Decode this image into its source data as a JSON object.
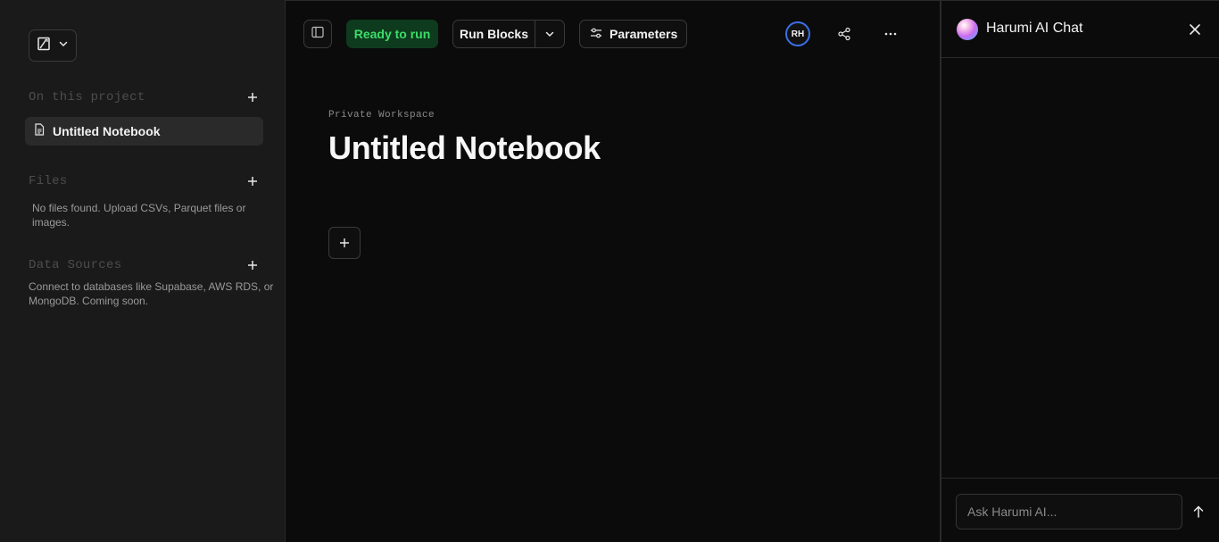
{
  "sidebar": {
    "logo_icon": "notebook-logo-icon",
    "sections": {
      "project": {
        "title": "On this project"
      },
      "files": {
        "title": "Files",
        "hint": "No files found. Upload CSVs, Parquet files or images."
      },
      "data_sources": {
        "title": "Data Sources",
        "hint": "Connect to databases like Supabase, AWS RDS, or MongoDB. Coming soon."
      }
    },
    "notebooks": [
      {
        "label": "Untitled Notebook",
        "icon": "document-icon",
        "active": true
      }
    ]
  },
  "toolbar": {
    "status": "Ready to run",
    "status_color": "#3ddc6c",
    "run_label": "Run Blocks",
    "params_label": "Parameters",
    "avatar_initials": "RH",
    "avatar_ring_color": "#3b6fe8"
  },
  "notebook": {
    "workspace": "Private Workspace",
    "title": "Untitled Notebook"
  },
  "chat": {
    "title": "Harumi AI Chat",
    "input_placeholder": "Ask Harumi AI..."
  }
}
